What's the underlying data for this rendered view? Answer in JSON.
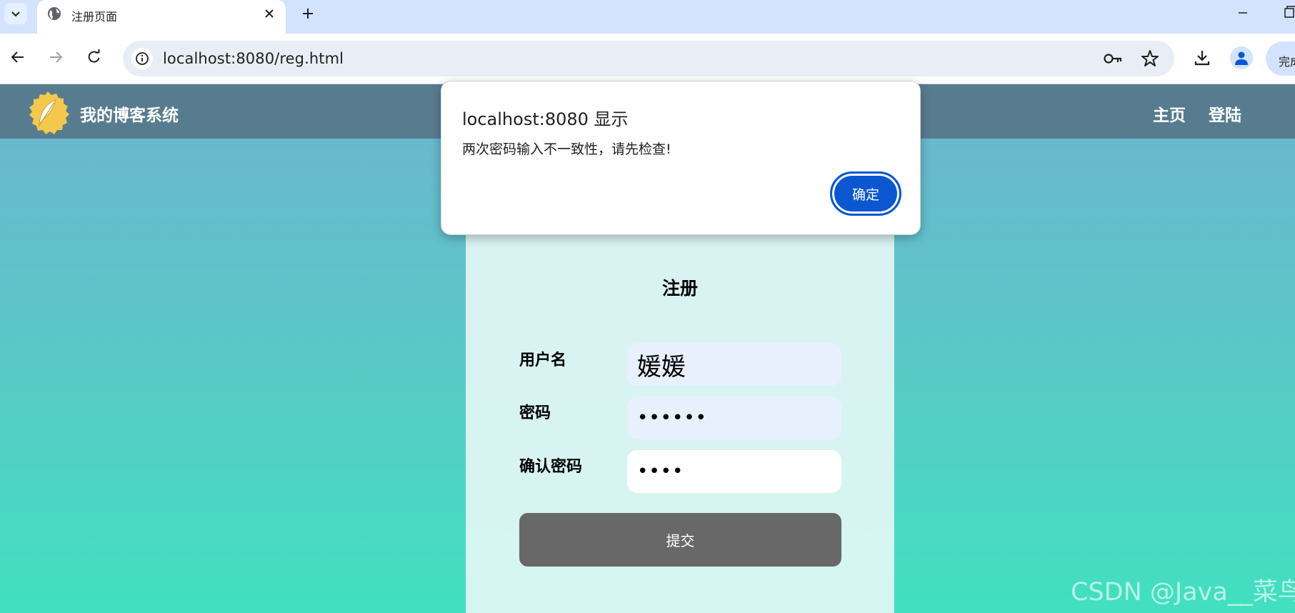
{
  "browser": {
    "tab": {
      "title": "注册页面"
    },
    "address_bar": {
      "url": "localhost:8080/reg.html"
    },
    "complete_button_label": "完成"
  },
  "site": {
    "name": "我的博客系统",
    "nav": [
      {
        "label": "主页"
      },
      {
        "label": "登陆"
      }
    ]
  },
  "form": {
    "title": "注册",
    "fields": [
      {
        "label": "用户名",
        "value": "媛媛"
      },
      {
        "label": "密码",
        "value": "••••••"
      },
      {
        "label": "确认密码",
        "value": "••••"
      }
    ],
    "submit_label": "提交"
  },
  "dialog": {
    "title": "localhost:8080 显示",
    "message": "两次密码输入不一致性，请先检查!",
    "ok_label": "确定"
  },
  "watermark": "CSDN @Java__菜鸟",
  "colors": {
    "tabstrip_bg": "#d3e3fd",
    "navbar_bg": "#587c8f",
    "gradient_top": "#6db5cf",
    "gradient_bottom": "#41e0c0",
    "submit_bg": "#686868",
    "dialog_button": "#0b57d0",
    "logo_yellow": "#f3c84c"
  },
  "icons": [
    "chevron-down-icon",
    "globe-icon",
    "close-icon",
    "plus-icon",
    "minimize-icon",
    "restore-icon",
    "back-arrow-icon",
    "forward-arrow-icon",
    "reload-icon",
    "info-icon",
    "key-icon",
    "star-icon",
    "download-icon",
    "profile-icon",
    "feather-logo-icon"
  ]
}
